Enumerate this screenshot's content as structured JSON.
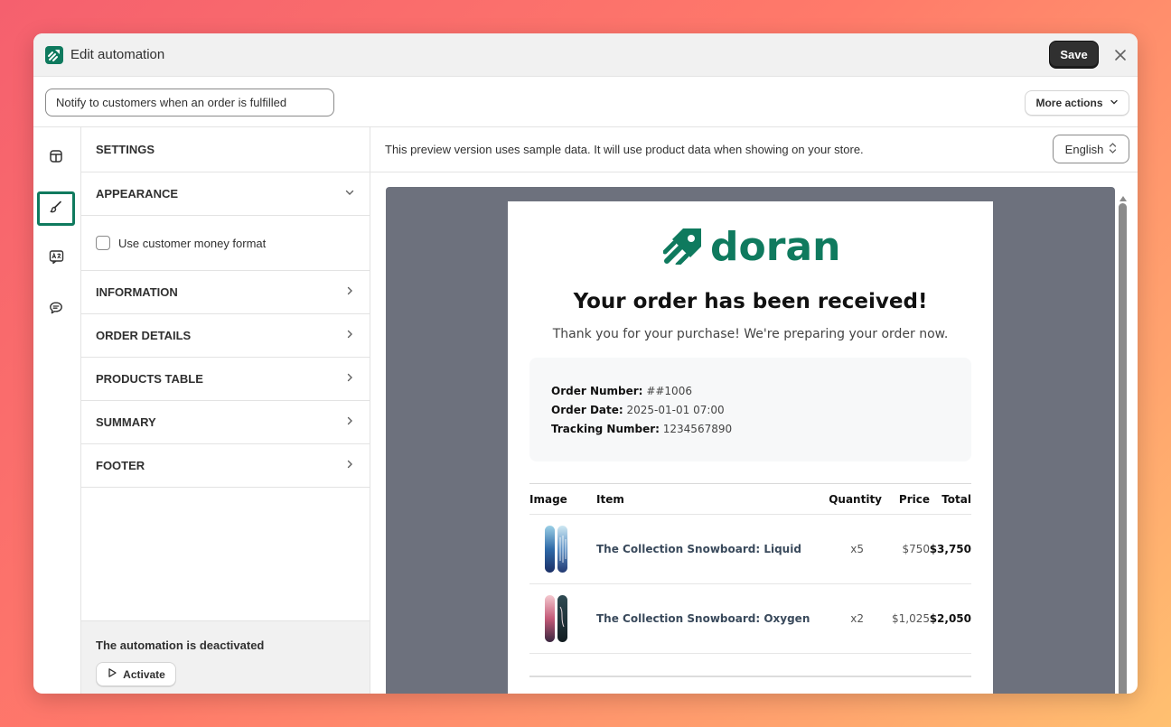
{
  "window": {
    "title": "Edit automation",
    "save_label": "Save"
  },
  "toolbar": {
    "automation_name": "Notify to customers when an order is fulfilled",
    "more_actions_label": "More actions"
  },
  "rail": {
    "items": [
      {
        "icon": "layout-icon"
      },
      {
        "icon": "paintbrush-icon",
        "active": true
      },
      {
        "icon": "translate-icon"
      },
      {
        "icon": "chat-icon"
      }
    ]
  },
  "settings": {
    "header": "SETTINGS",
    "appearance": "APPEARANCE",
    "money_format_label": "Use customer money format",
    "sections": [
      "INFORMATION",
      "ORDER DETAILS",
      "PRODUCTS TABLE",
      "SUMMARY",
      "FOOTER"
    ],
    "status_text": "The automation is deactivated",
    "activate_label": "Activate"
  },
  "preview": {
    "note": "This preview version uses sample data. It will use product data when showing on your store.",
    "language": "English"
  },
  "email": {
    "brand_name": "doran",
    "brand_color": "#0f7a5e",
    "title": "Your order has been received!",
    "subtitle": "Thank you for your purchase! We're preparing your order now.",
    "order": {
      "number_label": "Order Number:",
      "number_value": "##1006",
      "date_label": "Order Date:",
      "date_value": "2025-01-01 07:00",
      "tracking_label": "Tracking Number:",
      "tracking_value": "1234567890"
    },
    "table": {
      "headers": {
        "image": "Image",
        "item": "Item",
        "quantity": "Quantity",
        "price": "Price",
        "total": "Total"
      },
      "rows": [
        {
          "item": "The Collection Snowboard: Liquid",
          "quantity": "x5",
          "price": "$750",
          "total": "$3,750"
        },
        {
          "item": "The Collection Snowboard: Oxygen",
          "quantity": "x2",
          "price": "$1,025",
          "total": "$2,050"
        }
      ]
    }
  }
}
